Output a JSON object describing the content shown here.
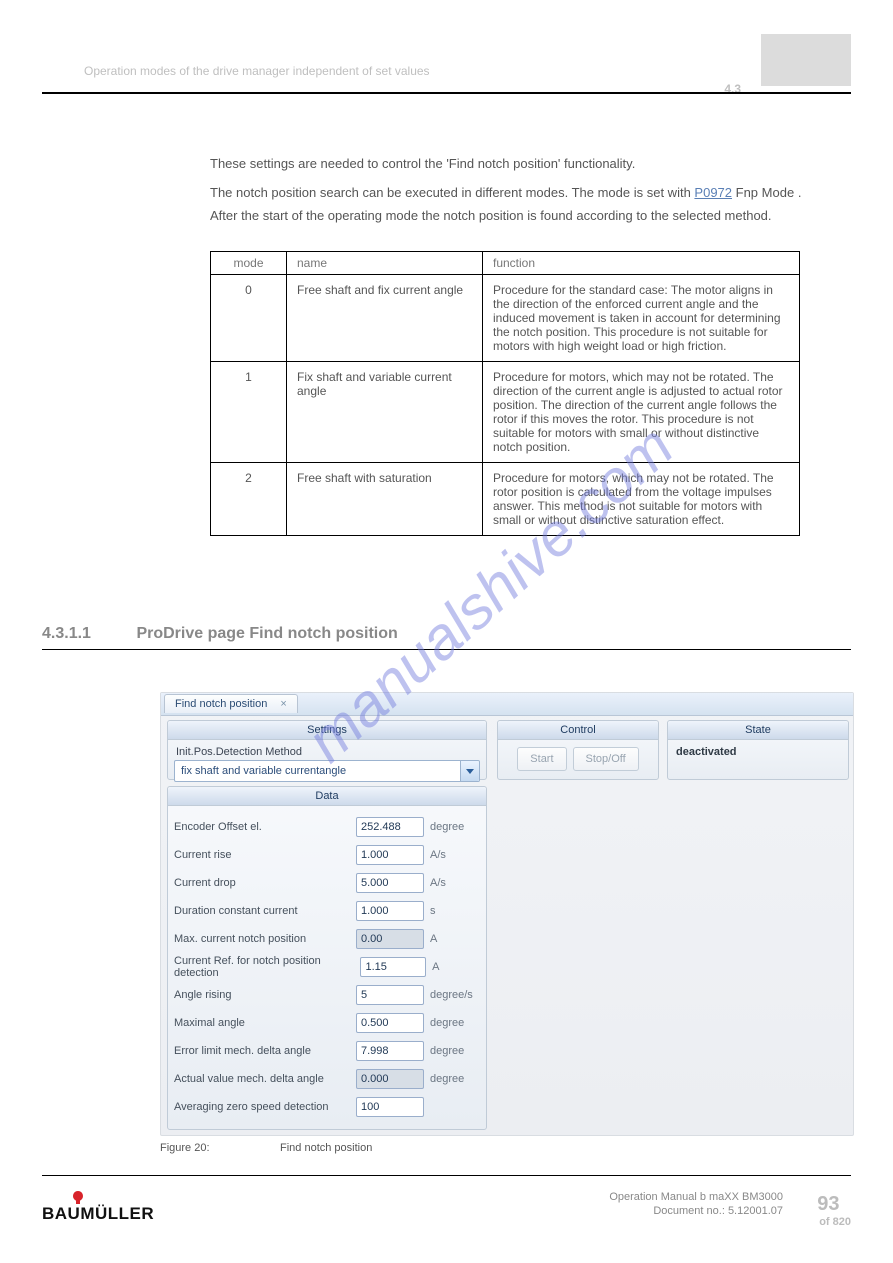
{
  "header": {
    "section_number": "4.3",
    "section_text": "Operation modes of the drive manager independent of set values",
    "manual_title": "Operation Manual   b maXX BM3000",
    "page_number": "93",
    "doc_id": "Document no.: 5.12001.07",
    "page_of": "of 820"
  },
  "intro": {
    "line1": "These settings are needed to control the 'Find notch position' functionality.",
    "line2": "The notch position search can be executed in different modes. The mode is set with ",
    "param_ref": "P0972",
    "param_name": " Fnp Mode",
    "line2_tail": ".",
    "subline": "After the start of the operating mode the notch position is found according to the selected method."
  },
  "table": {
    "head": {
      "c0": "mode",
      "c1": "name",
      "c2": "function"
    },
    "rows": [
      {
        "c0": "0",
        "c1": "Free shaft and fix current angle",
        "c2": "Procedure for the standard case: The motor aligns in the direction of the enforced current angle and the induced movement is taken in account for determining the notch position. This procedure is not suitable for motors with high weight load or high friction."
      },
      {
        "c0": "1",
        "c1": "Fix shaft and variable current angle",
        "c2": "Procedure for motors, which may not be rotated. The direction of the current angle is adjusted to actual rotor position. The direction of the current angle follows the rotor if this moves the rotor. This procedure is not suitable for motors with small or without distinctive notch position."
      },
      {
        "c0": "2",
        "c1": "Free shaft with saturation",
        "c2": "Procedure for motors, which may not be rotated. The rotor position is calculated from the voltage impulses answer. This method is not suitable for motors with small or without distinctive saturation effect."
      }
    ]
  },
  "watermark": "manualshive.com",
  "section": {
    "num": "4.3.1.1",
    "title": "ProDrive page Find notch position",
    "figure_label": "Figure 20:",
    "figure_desc": "Find notch position"
  },
  "ui": {
    "tab": {
      "label": "Find notch position",
      "close": "×"
    },
    "panels": {
      "settings": "Settings",
      "control": "Control",
      "state": "State",
      "data": "Data"
    },
    "settings": {
      "ipdm_label": "Init.Pos.Detection Method",
      "ipdm_value": "fix shaft and variable currentangle"
    },
    "control": {
      "start": "Start",
      "stop": "Stop/Off"
    },
    "state": {
      "value": "deactivated"
    },
    "data_rows": [
      {
        "label": "Encoder Offset el.",
        "value": "252.488",
        "unit": "degree",
        "ro": false
      },
      {
        "label": "Current rise",
        "value": "1.000",
        "unit": "A/s",
        "ro": false
      },
      {
        "label": "Current drop",
        "value": "5.000",
        "unit": "A/s",
        "ro": false
      },
      {
        "label": "Duration constant current",
        "value": "1.000",
        "unit": "s",
        "ro": false
      },
      {
        "label": "Max. current notch position",
        "value": "0.00",
        "unit": "A",
        "ro": true
      },
      {
        "label": "Current Ref. for notch position detection",
        "value": "1.15",
        "unit": "A",
        "ro": false
      },
      {
        "label": "Angle rising",
        "value": "5",
        "unit": "degree/s",
        "ro": false
      },
      {
        "label": "Maximal angle",
        "value": "0.500",
        "unit": "degree",
        "ro": false
      },
      {
        "label": "Error limit mech. delta angle",
        "value": "7.998",
        "unit": "degree",
        "ro": false
      },
      {
        "label": "Actual value mech. delta angle",
        "value": "0.000",
        "unit": "degree",
        "ro": true
      },
      {
        "label": "Averaging zero speed detection",
        "value": "100",
        "unit": "",
        "ro": false
      }
    ]
  },
  "logo_text": "BAUMÜLLER"
}
